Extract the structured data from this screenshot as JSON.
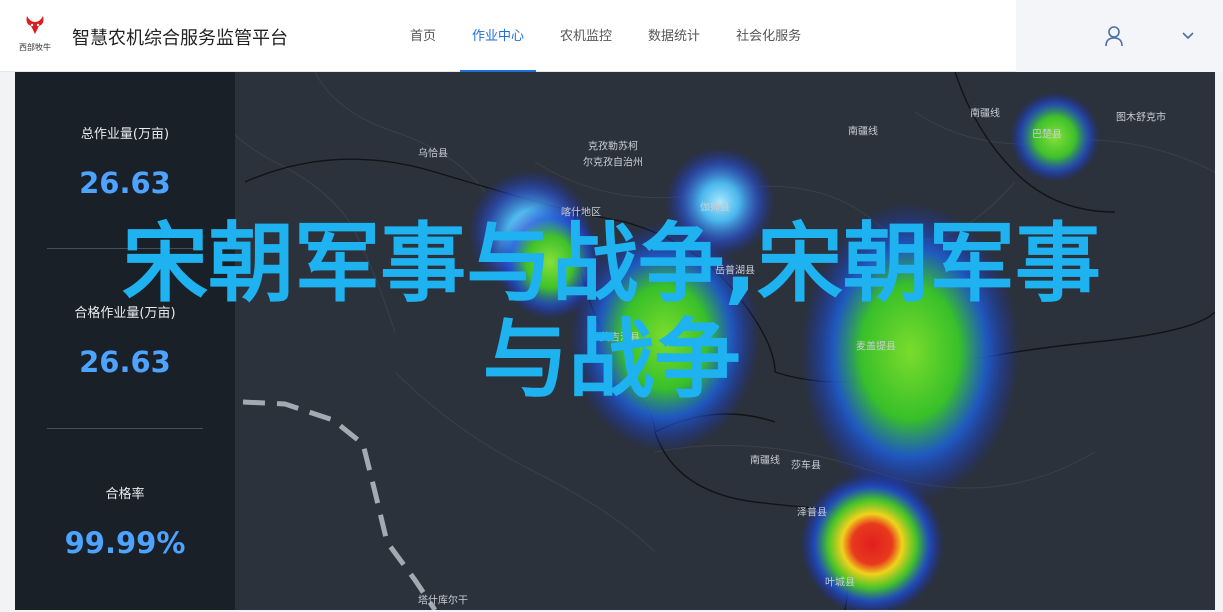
{
  "header": {
    "logo_text": "西部牧牛",
    "title": "智慧农机综合服务监管平台",
    "nav": [
      {
        "label": "首页",
        "active": false
      },
      {
        "label": "作业中心",
        "active": true
      },
      {
        "label": "农机监控",
        "active": false
      },
      {
        "label": "数据统计",
        "active": false
      },
      {
        "label": "社会化服务",
        "active": false
      }
    ],
    "user_icon": "user-icon",
    "dropdown_icon": "chevron-down-icon"
  },
  "stats": [
    {
      "label": "总作业量(万亩)",
      "value": "26.63"
    },
    {
      "label": "合格作业量(万亩)",
      "value": "26.63"
    },
    {
      "label": "合格率",
      "value": "99.99%"
    }
  ],
  "map": {
    "places": [
      {
        "name": "乌恰县"
      },
      {
        "name": "克孜勒苏柯"
      },
      {
        "name": "尔克孜自治州"
      },
      {
        "name": "喀什地区"
      },
      {
        "name": "伽师县"
      },
      {
        "name": "岳普湖县"
      },
      {
        "name": "英吉沙县"
      },
      {
        "name": "麦盖提县"
      },
      {
        "name": "南疆线"
      },
      {
        "name": "南疆线"
      },
      {
        "name": "图木舒克市"
      },
      {
        "name": "巴楚县"
      },
      {
        "name": "南疆线"
      },
      {
        "name": "莎车县"
      },
      {
        "name": "泽普县"
      },
      {
        "name": "叶城县"
      },
      {
        "name": "塔什库尔干"
      }
    ]
  },
  "overlay": {
    "line1": "宋朝军事与战争,宋朝军事",
    "line2": "与战争"
  },
  "colors": {
    "accent": "#1e6fd9",
    "stat_value": "#4da3ff",
    "headline": "#1fb2f0",
    "map_bg": "#2b323b"
  }
}
